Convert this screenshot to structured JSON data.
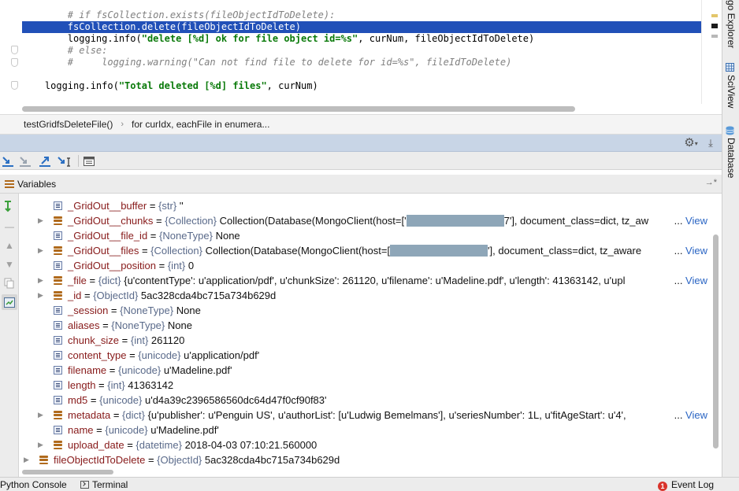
{
  "editor": {
    "lines": [
      {
        "parts": [
          {
            "text": "        ",
            "cls": ""
          },
          {
            "text": "# if fsCollection.exists(fileObjectIdToDelete):",
            "cls": "tok-comment"
          }
        ]
      },
      {
        "parts": [
          {
            "text": "        fsCollection.delete(fileObjectIdToDelete)",
            "cls": ""
          }
        ],
        "selected": true
      },
      {
        "parts": [
          {
            "text": "        logging.info(",
            "cls": ""
          },
          {
            "text": "\"delete [%d] ok for file object id=%s\"",
            "cls": "tok-str"
          },
          {
            "text": ", curNum, fileObjectIdToDelete)",
            "cls": ""
          }
        ]
      },
      {
        "parts": [
          {
            "text": "        ",
            "cls": ""
          },
          {
            "text": "# else:",
            "cls": "tok-comment"
          }
        ]
      },
      {
        "parts": [
          {
            "text": "        ",
            "cls": ""
          },
          {
            "text": "#     logging.warning(\"Can not find file to delete for id=%s\", fileIdToDelete)",
            "cls": "tok-comment"
          }
        ]
      },
      {
        "parts": [
          {
            "text": "",
            "cls": ""
          }
        ]
      },
      {
        "parts": [
          {
            "text": "    logging.info(",
            "cls": ""
          },
          {
            "text": "\"Total deleted [%d] files\"",
            "cls": "tok-str"
          },
          {
            "text": ", curNum)",
            "cls": ""
          }
        ]
      }
    ]
  },
  "breadcrumb": {
    "items": [
      "testGridfsDeleteFile()",
      "for curIdx, eachFile in enumera..."
    ],
    "separator": "›"
  },
  "variables_panel": {
    "title": "Variables",
    "view_label": "View",
    "rows": [
      {
        "name": "_GridOut__buffer",
        "type": "{str}",
        "value": "''",
        "icon": "field",
        "expandable": false,
        "indent": 1
      },
      {
        "name": "_GridOut__chunks",
        "type": "{Collection}",
        "value_before": "Collection(Database(MongoClient(host=['",
        "redacted": true,
        "value_after": "7'], document_class=dict, tz_aw",
        "view": true,
        "icon": "object",
        "expandable": true,
        "indent": 1
      },
      {
        "name": "_GridOut__file_id",
        "type": "{NoneType}",
        "value": "None",
        "icon": "field",
        "expandable": false,
        "indent": 1
      },
      {
        "name": "_GridOut__files",
        "type": "{Collection}",
        "value_before": "Collection(Database(MongoClient(host=[",
        "redacted": true,
        "value_after": "'], document_class=dict, tz_aware",
        "view": true,
        "icon": "object",
        "expandable": true,
        "indent": 1
      },
      {
        "name": "_GridOut__position",
        "type": "{int}",
        "value": "0",
        "icon": "field",
        "expandable": false,
        "indent": 1
      },
      {
        "name": "_file",
        "type": "{dict}",
        "value": "{u'contentType': u'application/pdf', u'chunkSize': 261120, u'filename': u'Madeline.pdf', u'length': 41363142, u'upl",
        "view": true,
        "icon": "object",
        "expandable": true,
        "indent": 1
      },
      {
        "name": "_id",
        "type": "{ObjectId}",
        "value": "5ac328cda4bc715a734b629d",
        "icon": "object",
        "expandable": true,
        "indent": 1
      },
      {
        "name": "_session",
        "type": "{NoneType}",
        "value": "None",
        "icon": "field",
        "expandable": false,
        "indent": 1
      },
      {
        "name": "aliases",
        "type": "{NoneType}",
        "value": "None",
        "icon": "field",
        "expandable": false,
        "indent": 1
      },
      {
        "name": "chunk_size",
        "type": "{int}",
        "value": "261120",
        "icon": "field",
        "expandable": false,
        "indent": 1
      },
      {
        "name": "content_type",
        "type": "{unicode}",
        "value": "u'application/pdf'",
        "icon": "field",
        "expandable": false,
        "indent": 1
      },
      {
        "name": "filename",
        "type": "{unicode}",
        "value": "u'Madeline.pdf'",
        "icon": "field",
        "expandable": false,
        "indent": 1
      },
      {
        "name": "length",
        "type": "{int}",
        "value": "41363142",
        "icon": "field",
        "expandable": false,
        "indent": 1
      },
      {
        "name": "md5",
        "type": "{unicode}",
        "value": "u'd4a39c2396586560dc64d47f0cf90f83'",
        "icon": "field",
        "expandable": false,
        "indent": 1
      },
      {
        "name": "metadata",
        "type": "{dict}",
        "value": "{u'publisher': u'Penguin US', u'authorList': [u'Ludwig Bemelmans'], u'seriesNumber': 1L, u'fitAgeStart': u'4',",
        "view": true,
        "icon": "object",
        "expandable": true,
        "indent": 1
      },
      {
        "name": "name",
        "type": "{unicode}",
        "value": "u'Madeline.pdf'",
        "icon": "field",
        "expandable": false,
        "indent": 1
      },
      {
        "name": "upload_date",
        "type": "{datetime}",
        "value": "2018-04-03 07:10:21.560000",
        "icon": "object",
        "expandable": true,
        "indent": 1
      },
      {
        "name": "fileObjectIdToDelete",
        "type": "{ObjectId}",
        "value": "5ac328cda4bc715a734b629d",
        "icon": "object",
        "expandable": true,
        "indent": 0
      }
    ]
  },
  "bottom_bar": {
    "python_console": "Python Console",
    "terminal": "Terminal",
    "event_log": "Event Log",
    "event_count": "1"
  },
  "right_strip": {
    "tabs": [
      "go Explorer",
      "SciView",
      "Database"
    ]
  },
  "colors": {
    "selection": "#2150b8",
    "panel_header": "#c8d5e6",
    "var_name": "#871a1a",
    "link": "#2a65c4",
    "redaction": "#8ea6b8"
  }
}
